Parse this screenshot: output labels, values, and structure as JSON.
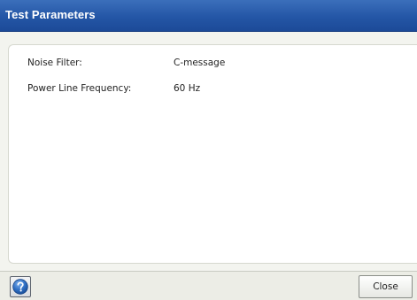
{
  "window": {
    "title": "Test Parameters"
  },
  "parameters": [
    {
      "label": "Noise Filter:",
      "value": "C-message"
    },
    {
      "label": "Power Line Frequency:",
      "value": "60 Hz"
    }
  ],
  "footer": {
    "help_icon": "help-icon",
    "close_label": "Close"
  },
  "colors": {
    "titlebar": "#2456a6",
    "help_icon": "#2f6fc4"
  }
}
